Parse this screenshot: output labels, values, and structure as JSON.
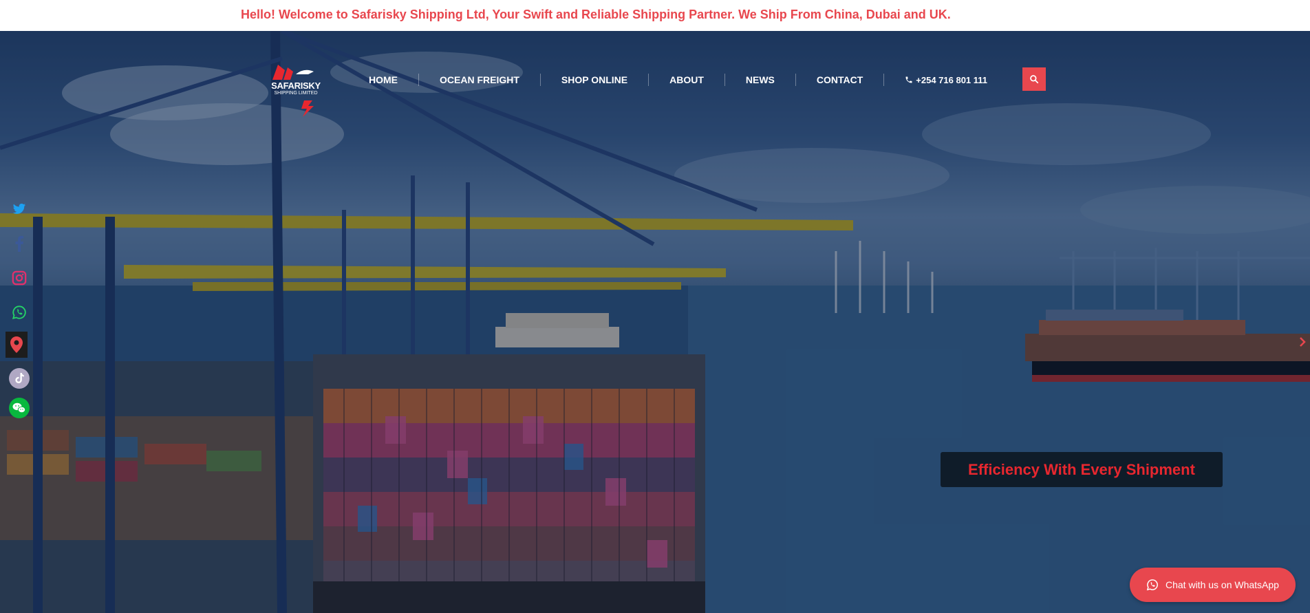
{
  "welcome_bar": {
    "text": "Hello! Welcome to Safarisky Shipping Ltd, Your Swift and Reliable Shipping Partner. We Ship From China, Dubai and UK."
  },
  "logo": {
    "name": "SAFARISKY",
    "subtitle": "SHIPPING LIMITED"
  },
  "nav": {
    "items": [
      {
        "label": "HOME"
      },
      {
        "label": "OCEAN FREIGHT"
      },
      {
        "label": "SHOP ONLINE"
      },
      {
        "label": "ABOUT"
      },
      {
        "label": "NEWS"
      },
      {
        "label": "CONTACT"
      }
    ],
    "phone": "+254 716 801 111",
    "phone_icon": "phone-icon",
    "search_icon": "search-icon"
  },
  "social": [
    {
      "icon": "twitter-icon",
      "color": "#1da1f2"
    },
    {
      "icon": "facebook-icon",
      "color": "#3b5998"
    },
    {
      "icon": "instagram-icon",
      "color": "#e1306c"
    },
    {
      "icon": "whatsapp-icon",
      "color": "#25d366"
    },
    {
      "icon": "map-pin-icon",
      "color": "#e8474e"
    },
    {
      "icon": "tiktok-icon",
      "color": "#ffffff"
    },
    {
      "icon": "wechat-icon",
      "color": "#09b83e"
    }
  ],
  "hero": {
    "caption": "Efficiency With Every Shipment",
    "next_icon": "chevron-right-icon"
  },
  "chat": {
    "label": "Chat with us on WhatsApp",
    "icon": "whatsapp-icon"
  },
  "colors": {
    "accent": "#e8474e",
    "caption_text": "#e8272f",
    "crane_yellow": "#d9c020",
    "crane_blue": "#1f3f7a"
  }
}
